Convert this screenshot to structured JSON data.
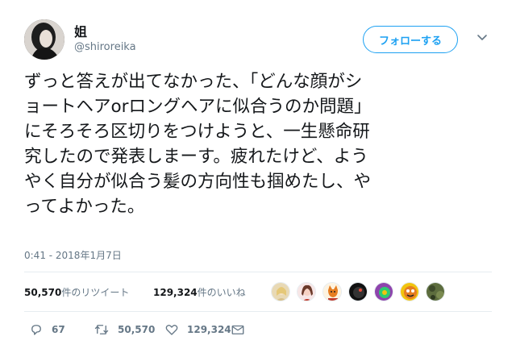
{
  "user": {
    "name": "姐",
    "handle": "@shiroreika"
  },
  "follow_button": {
    "label": "フォローする"
  },
  "tweet": {
    "lines": [
      "ずっと答えが出てなかった、「どんな顔がシ",
      "ョートヘアorロングヘアに似合うのか問題」",
      "にそろそろ区切りをつけようと、一生懸命研",
      "究したので発表しまーす。疲れたけど、よう",
      "やく自分が似合う髪の方向性も掴めたし、や",
      "ってよかった。"
    ]
  },
  "timestamp": "0:41 - 2018年1月7日",
  "stats": {
    "retweets_count": "50,570",
    "retweets_suffix": "件のリツイート",
    "likes_count": "129,324",
    "likes_suffix": "件のいいね"
  },
  "likers": [
    {
      "icon": "avatar-blonde",
      "color": "#e8d9b5"
    },
    {
      "icon": "avatar-girl",
      "color": "#f2c7c7"
    },
    {
      "icon": "avatar-fox",
      "color": "#f4e6cc"
    },
    {
      "icon": "avatar-dark",
      "color": "#222222"
    },
    {
      "icon": "avatar-colorful",
      "color": "#9b59b6"
    },
    {
      "icon": "avatar-yellow",
      "color": "#f1c40f"
    },
    {
      "icon": "avatar-camo",
      "color": "#5d6d3e"
    }
  ],
  "actions": {
    "reply_count": "67",
    "retweet_count": "50,570",
    "like_count": "129,324"
  },
  "colors": {
    "accent": "#1da1f2",
    "secondary_text": "#657786",
    "divider": "#e6ecf0"
  }
}
